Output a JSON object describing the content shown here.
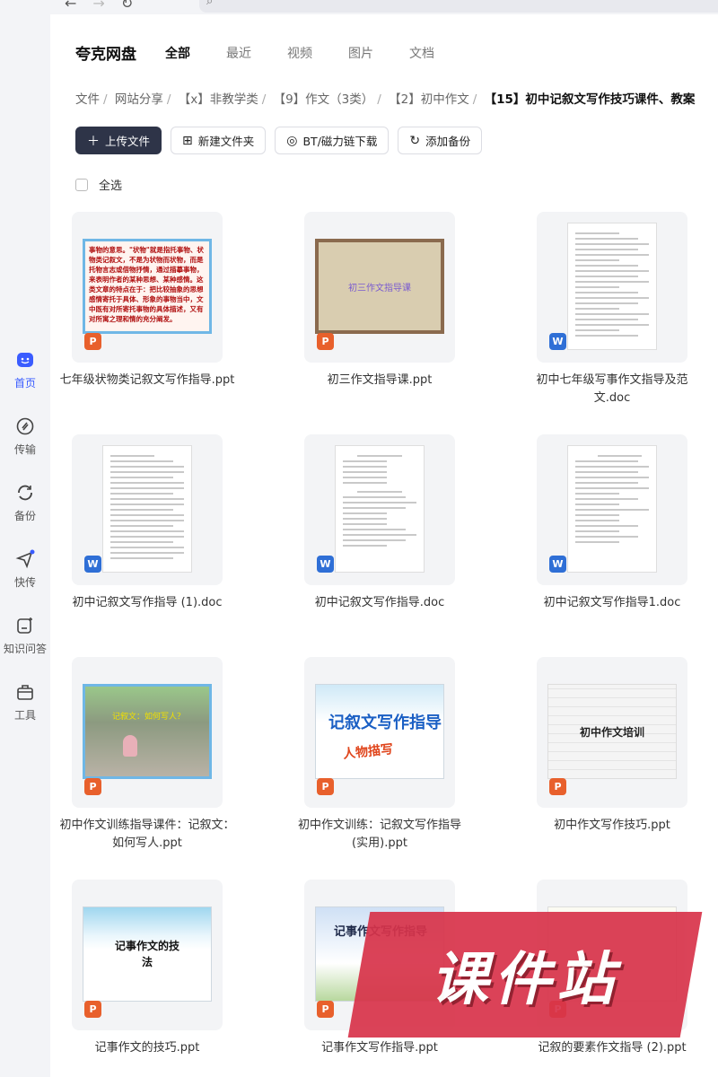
{
  "app": {
    "brand": "夸克网盘"
  },
  "tabs": [
    "全部",
    "最近",
    "视频",
    "图片",
    "文档"
  ],
  "sidebar": {
    "items": [
      {
        "label": "首页",
        "icon": "home-icon",
        "active": true
      },
      {
        "label": "传输",
        "icon": "transfer-icon"
      },
      {
        "label": "备份",
        "icon": "backup-icon"
      },
      {
        "label": "快传",
        "icon": "quick-send-icon"
      },
      {
        "label": "知识问答",
        "icon": "qa-icon"
      },
      {
        "label": "工具",
        "icon": "toolbox-icon"
      }
    ]
  },
  "breadcrumb": [
    "文件",
    "网站分享",
    "【x】非教学类",
    "【9】作文（3类）",
    "【2】初中作文",
    "【15】初中记叙文写作技巧课件、教案"
  ],
  "actions": {
    "upload": "上传文件",
    "new_folder": "新建文件夹",
    "bt_download": "BT/磁力链下载",
    "add_backup": "添加备份"
  },
  "select_all": "全选",
  "files": [
    {
      "name": "七年级状物类记叙文写作指导.ppt",
      "type": "ppt",
      "thumb_text": "事物的意思。\"状物\"就是指托事物、状物类记叙文，不是为状物而状物，而是托物言志或借物抒情，通过描摹事物，来表明作者的某种思想、某种感情。这类文章的特点在于：把比较抽象的思想感情寄托于具体、形象的事物当中，文中既有对所寄托事物的具体描述，又有对所寓之理和情的充分阐发。"
    },
    {
      "name": "初三作文指导课.ppt",
      "type": "ppt",
      "thumb_text": "初三作文指导课"
    },
    {
      "name": "初中七年级写事作文指导及范文.doc",
      "type": "doc"
    },
    {
      "name": "初中记叙文写作指导 (1).doc",
      "type": "doc"
    },
    {
      "name": "初中记叙文写作指导.doc",
      "type": "doc"
    },
    {
      "name": "初中记叙文写作指导1.doc",
      "type": "doc"
    },
    {
      "name": "初中作文训练指导课件：记叙文：如何写人.ppt",
      "type": "ppt",
      "thumb_text": "记叙文：如何写人？"
    },
    {
      "name": "初中作文训练：记叙文写作指导(实用).ppt",
      "type": "ppt",
      "thumb_text": "记叙文写作指导",
      "thumb_sub": "人物描写"
    },
    {
      "name": "初中作文写作技巧.ppt",
      "type": "ppt",
      "thumb_text": "初中作文培训"
    },
    {
      "name": "记事作文的技巧.ppt",
      "type": "ppt",
      "thumb_text": "记事作文的技法"
    },
    {
      "name": "记事作文写作指导.ppt",
      "type": "ppt",
      "thumb_text": "记事作文写作指导"
    },
    {
      "name": "记叙的要素作文指导 (2).ppt",
      "type": "ppt"
    }
  ],
  "watermark": "课件站"
}
